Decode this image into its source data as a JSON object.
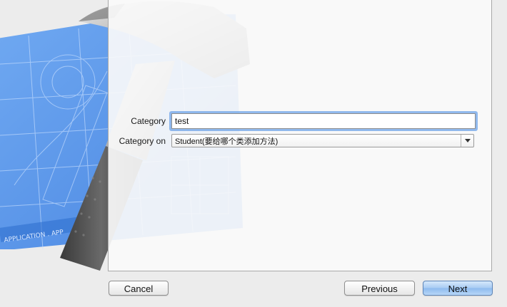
{
  "form": {
    "category_label": "Category",
    "category_value": "test",
    "category_on_label": "Category on",
    "category_on_value": "Student(要给哪个类添加方法)"
  },
  "buttons": {
    "cancel": "Cancel",
    "previous": "Previous",
    "next": "Next"
  },
  "artwork": {
    "blueprint_text": "APPLICATION . APP"
  },
  "colors": {
    "blueprint": "#4a8be8",
    "focus_ring": "#6da3e8",
    "primary_button": "#9cc4f1"
  }
}
